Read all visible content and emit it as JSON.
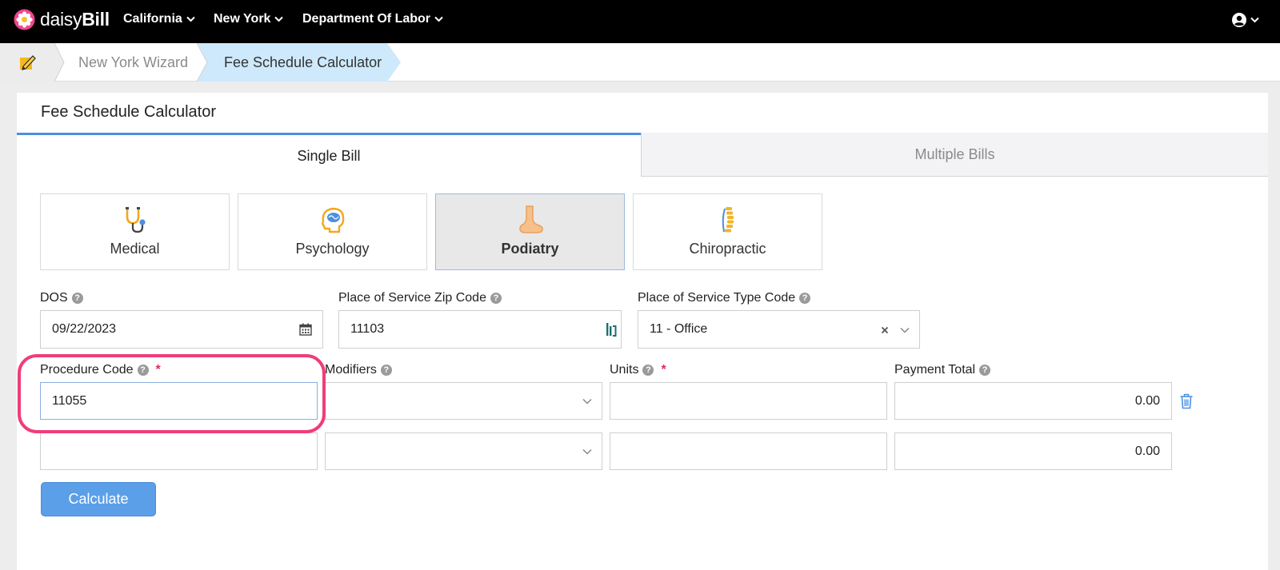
{
  "app": {
    "brand_prefix": "daisy",
    "brand_suffix": "Bill"
  },
  "nav": {
    "items": [
      {
        "label": "California"
      },
      {
        "label": "New York"
      },
      {
        "label": "Department Of Labor"
      }
    ]
  },
  "breadcrumb": {
    "items": [
      {
        "label": "New York Wizard"
      },
      {
        "label": "Fee Schedule Calculator"
      }
    ]
  },
  "page": {
    "title": "Fee Schedule Calculator"
  },
  "tabs": [
    {
      "label": "Single Bill",
      "active": true
    },
    {
      "label": "Multiple Bills",
      "active": false
    }
  ],
  "specialties": [
    {
      "label": "Medical",
      "icon": "stethoscope-icon",
      "active": false
    },
    {
      "label": "Psychology",
      "icon": "brain-icon",
      "active": false
    },
    {
      "label": "Podiatry",
      "icon": "foot-icon",
      "active": true
    },
    {
      "label": "Chiropractic",
      "icon": "spine-icon",
      "active": false
    }
  ],
  "form": {
    "dos": {
      "label": "DOS",
      "value": "09/22/2023"
    },
    "zip": {
      "label": "Place of Service Zip Code",
      "value": "11103"
    },
    "pos_type": {
      "label": "Place of Service Type Code",
      "value": "11 - Office"
    },
    "columns": {
      "procedure_code": "Procedure Code",
      "modifiers": "Modifiers",
      "units": "Units",
      "payment_total": "Payment Total"
    },
    "required_mark": "*",
    "rows": [
      {
        "procedure_code": "11055",
        "modifiers": "",
        "units": "",
        "payment_total": "0.00"
      },
      {
        "procedure_code": "",
        "modifiers": "",
        "units": "",
        "payment_total": "0.00"
      }
    ]
  },
  "actions": {
    "calculate_label": "Calculate"
  },
  "colors": {
    "accent": "#5b9fe8",
    "highlight": "#f03d7a",
    "required": "#d92c5a",
    "breadcrumb_active": "#cde9fb"
  }
}
